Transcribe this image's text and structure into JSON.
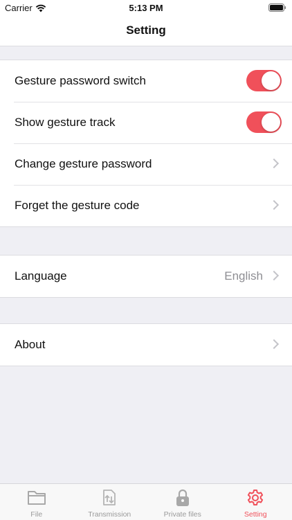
{
  "status_bar": {
    "carrier": "Carrier",
    "time": "5:13 PM"
  },
  "nav": {
    "title": "Setting"
  },
  "groups": {
    "gesture": {
      "items": [
        {
          "label": "Gesture password switch",
          "toggle_on": true
        },
        {
          "label": "Show gesture track",
          "toggle_on": true
        },
        {
          "label": "Change gesture password"
        },
        {
          "label": "Forget the gesture code"
        }
      ]
    },
    "language": {
      "label": "Language",
      "value": "English"
    },
    "about": {
      "label": "About"
    }
  },
  "tabs": [
    {
      "label": "File",
      "icon": "folder-icon"
    },
    {
      "label": "Transmission",
      "icon": "transfer-icon"
    },
    {
      "label": "Private files",
      "icon": "lock-icon"
    },
    {
      "label": "Setting",
      "icon": "gear-icon",
      "active": true
    }
  ],
  "colors": {
    "accent": "#f0505a",
    "background": "#efeff4",
    "chevron": "#c4c4c9"
  }
}
